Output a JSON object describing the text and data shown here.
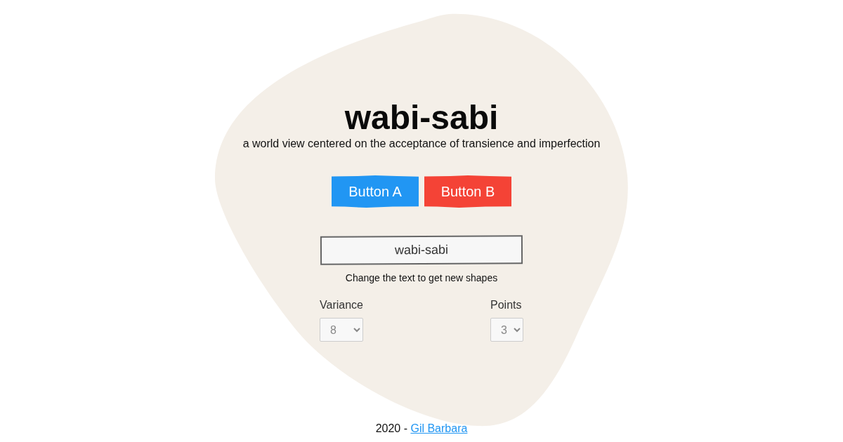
{
  "header": {
    "title": "wabi-sabi",
    "subtitle": "a world view centered on the acceptance of transience and imperfection"
  },
  "buttons": [
    {
      "label": "Button A",
      "color": "#2196f3"
    },
    {
      "label": "Button B",
      "color": "#f44336"
    }
  ],
  "text_field": {
    "value": "wabi-sabi",
    "hint": "Change the text to get new shapes"
  },
  "selects": [
    {
      "label": "Variance",
      "value": "8"
    },
    {
      "label": "Points",
      "value": "3"
    }
  ],
  "footer": {
    "text": "2020 -",
    "link": "Gil Barbara"
  }
}
